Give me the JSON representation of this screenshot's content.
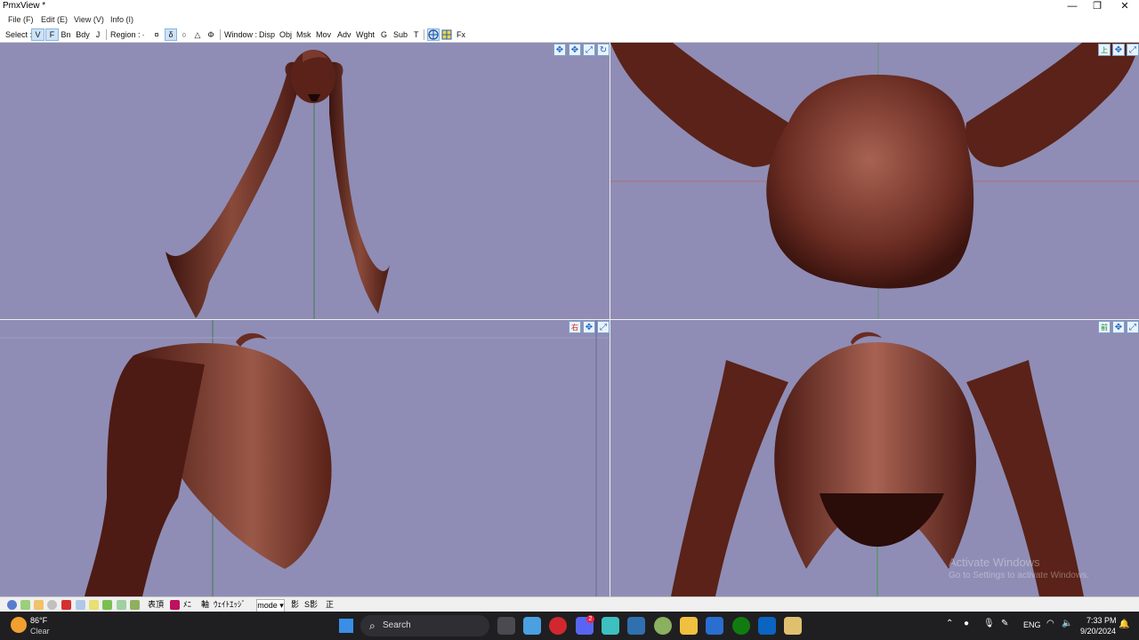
{
  "window": {
    "title": "PmxView *",
    "minimize": "—",
    "maximize": "❐",
    "close": "✕"
  },
  "menu": [
    "File (F)",
    "Edit (E)",
    "View (V)",
    "Info (I)"
  ],
  "toolbar": {
    "select_label": "Select :",
    "select_items": [
      "V",
      "F",
      "Bn",
      "Bdy",
      "J"
    ],
    "region_label": "Region :",
    "region_items": [
      "·",
      "¤",
      "δ",
      "○",
      "△",
      "Φ"
    ],
    "window_label": "Window :",
    "window_items": [
      "Disp",
      "Obj",
      "Msk",
      "Mov",
      "Adv",
      "Wght",
      "G",
      "Sub",
      "T"
    ],
    "fx_label": "Fx"
  },
  "viewports": {
    "top_right_view_label": "上",
    "bottom_left_view_label": "右",
    "bottom_right_view_label": "前"
  },
  "bottombar": {
    "surface_label": "表頂",
    "edge_label": "ﾒﾆ",
    "axis_label": "軸",
    "weight_label": "ｳｪｲﾄ",
    "edge2_label": "ｴｯｼﾞ",
    "mode_label": "mode ▾",
    "shadow_label": "影",
    "sshadow_label": "S影",
    "ortho_label": "正"
  },
  "watermark": {
    "line1": "Activate Windows",
    "line2": "Go to Settings to activate Windows."
  },
  "taskbar": {
    "weather_temp": "86°F",
    "weather_desc": "Clear",
    "search_placeholder": "Search",
    "lang": "ENG",
    "time": "7:33 PM",
    "date": "9/20/2024",
    "discord_badge": "2"
  },
  "colors": {
    "viewport_bg": "#8f8db5",
    "hair_dark": "#4a1a14",
    "hair_mid": "#7a3a2e",
    "hair_light": "#b0705e"
  }
}
